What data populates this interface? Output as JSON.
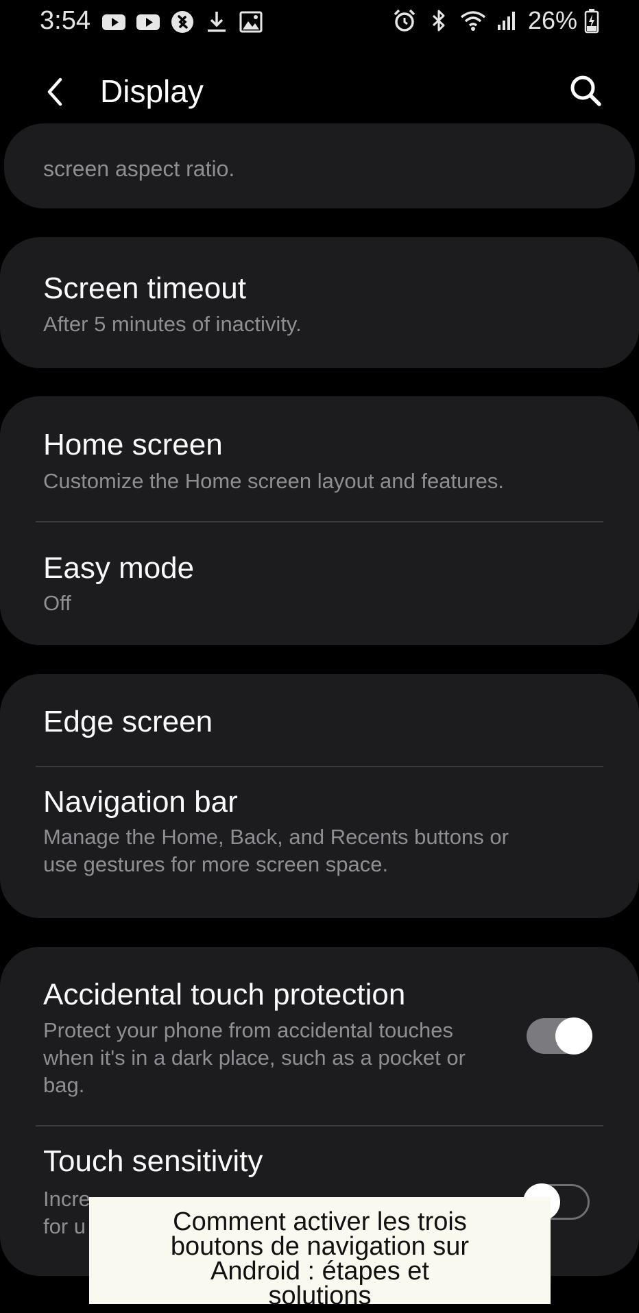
{
  "status_bar": {
    "time": "3:54",
    "battery": "26%",
    "left_icons": [
      "youtube-icon",
      "youtube-icon",
      "shazam-icon",
      "download-icon",
      "gallery-icon"
    ],
    "right_icons": [
      "alarm-icon",
      "bluetooth-icon",
      "wifi-icon",
      "signal-icon",
      "battery-icon"
    ]
  },
  "app_bar": {
    "title": "Display",
    "back_icon": "back-arrow-icon",
    "search_icon": "search-icon"
  },
  "sections": {
    "aspect_ratio": {
      "subtitle": "screen aspect ratio."
    },
    "screen_timeout": {
      "title": "Screen timeout",
      "subtitle": "After 5 minutes of inactivity."
    },
    "home_screen": {
      "title": "Home screen",
      "subtitle": "Customize the Home screen layout and features."
    },
    "easy_mode": {
      "title": "Easy mode",
      "subtitle": "Off"
    },
    "edge_screen": {
      "title": "Edge screen"
    },
    "navigation_bar": {
      "title": "Navigation bar",
      "subtitle_line1": "Manage the Home, Back, and Recents buttons or",
      "subtitle_line2": "use gestures for more screen space."
    },
    "accidental_touch": {
      "title": "Accidental touch protection",
      "subtitle_line1": "Protect your phone from accidental touches",
      "subtitle_line2": "when it's in a dark place, such as a pocket or",
      "subtitle_line3": "bag.",
      "enabled": true
    },
    "touch_sensitivity": {
      "title": "Touch sensitivity",
      "subtitle_line1": "Incre",
      "subtitle_line2": "for u",
      "enabled": false
    }
  },
  "overlay_caption": {
    "line1": "Comment activer les trois",
    "line2": "boutons de navigation sur",
    "line3": "Android : étapes et",
    "line4": "solutions"
  },
  "colors": {
    "background": "#000000",
    "card": "#1c1c1e",
    "subtitle": "#8e8e93",
    "toggle_on_track": "#7b7b7f",
    "overlay": "#faf9f0"
  }
}
